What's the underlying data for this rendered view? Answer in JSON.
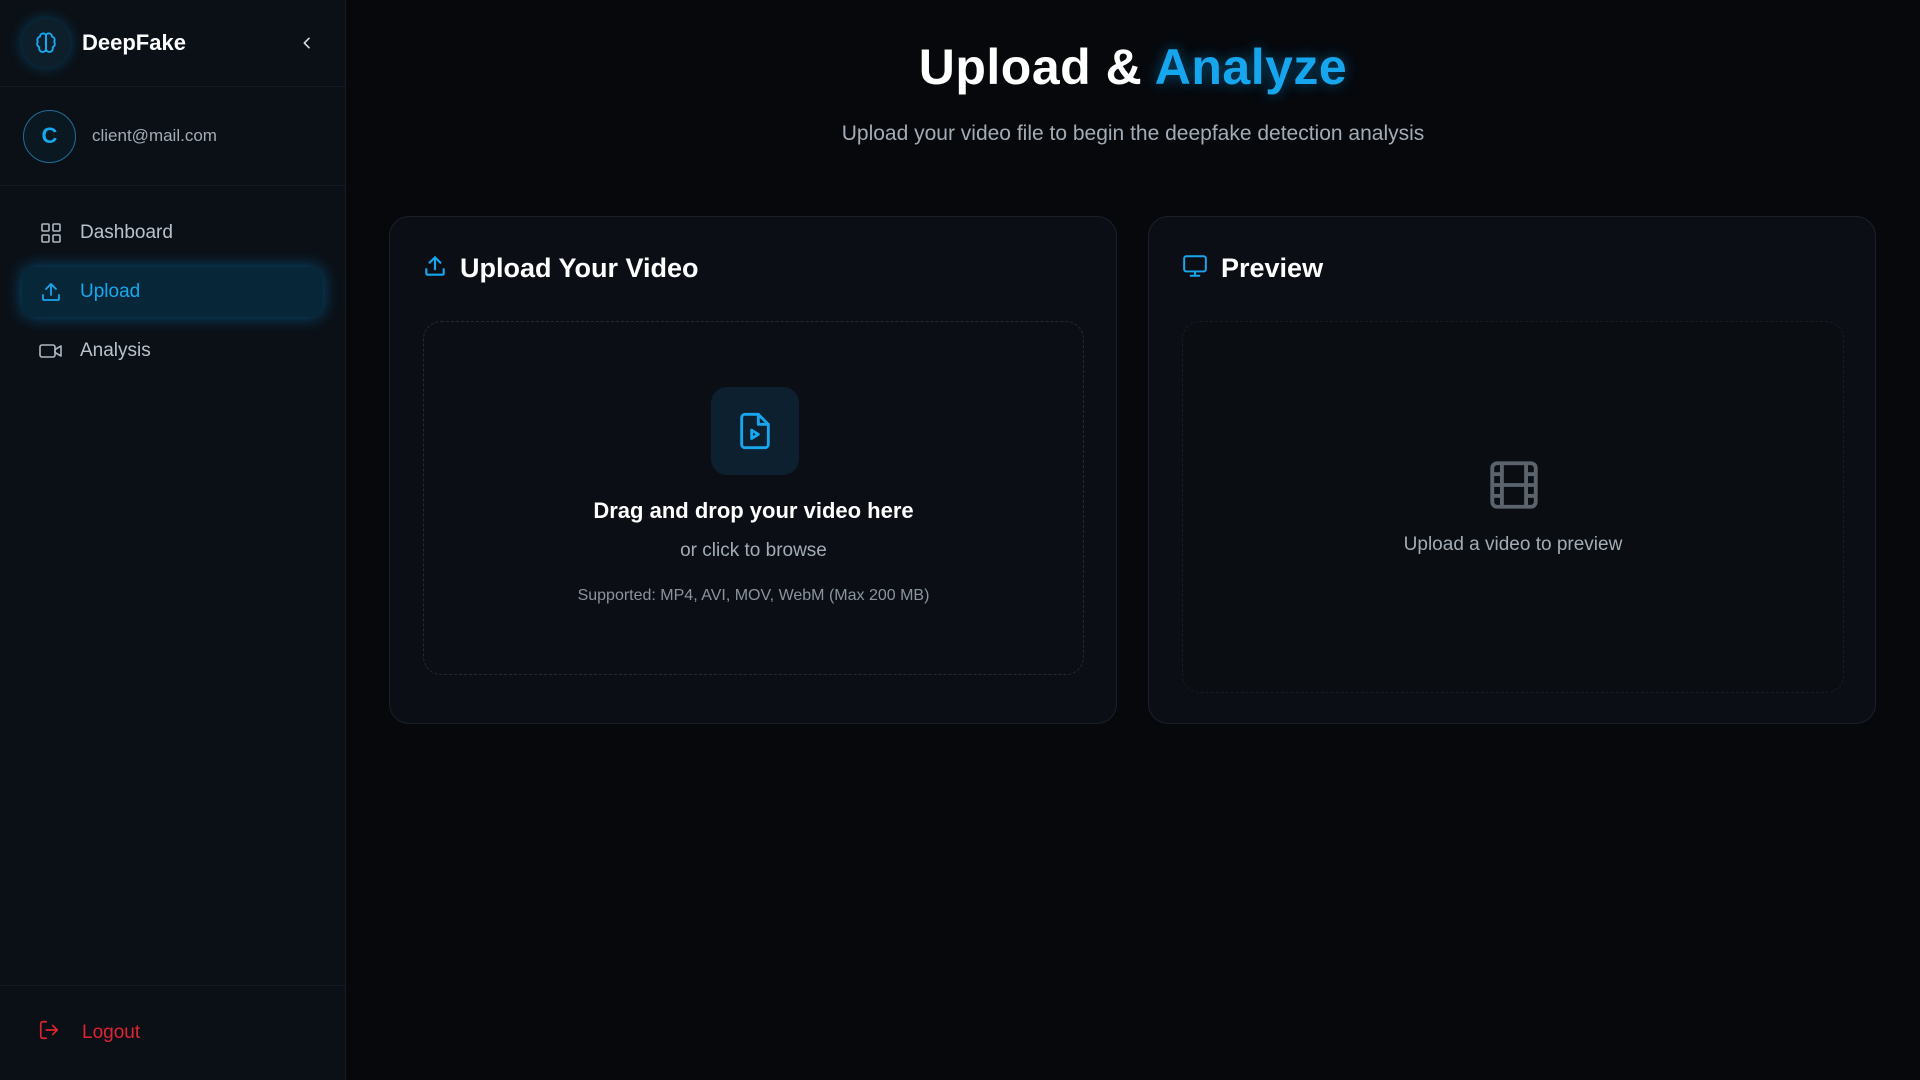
{
  "app": {
    "name": "DeepFake"
  },
  "user": {
    "initial": "C",
    "email": "client@mail.com"
  },
  "sidebar": {
    "items": [
      {
        "label": "Dashboard",
        "icon": "grid-icon",
        "active": false
      },
      {
        "label": "Upload",
        "icon": "upload-icon",
        "active": true
      },
      {
        "label": "Analysis",
        "icon": "video-camera-icon",
        "active": false
      }
    ],
    "logout_label": "Logout"
  },
  "header": {
    "title_main": "Upload &",
    "title_accent": "Analyze",
    "subtitle": "Upload your video file to begin the deepfake detection analysis"
  },
  "upload_card": {
    "title": "Upload Your Video",
    "drop_title": "Drag and drop your video here",
    "drop_sub": "or click to browse",
    "supported": "Supported: MP4, AVI, MOV, WebM (Max 200 MB)"
  },
  "preview_card": {
    "title": "Preview",
    "placeholder": "Upload a video to preview"
  },
  "colors": {
    "accent": "#16a6ee",
    "background": "#06080c",
    "sidebar": "#0b1016",
    "danger": "#e02431"
  }
}
